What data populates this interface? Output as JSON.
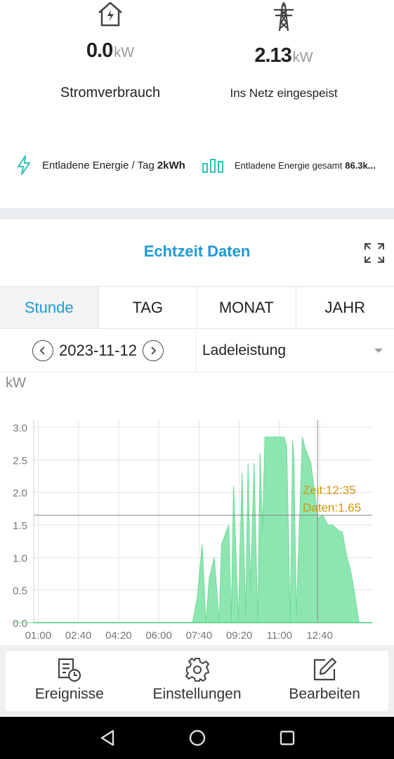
{
  "stats": {
    "consumption": {
      "value": "0.0",
      "unit": "kW",
      "label": "Stromverbrauch",
      "icon": "house-lightning-icon"
    },
    "grid": {
      "value": "2.13",
      "unit": "kW",
      "label": "Ins Netz eingespeist",
      "icon": "power-pylon-icon"
    }
  },
  "energy": {
    "daily": {
      "label": "Entladene Energie / Tag",
      "value": "2kWh",
      "icon": "lightning-icon"
    },
    "total": {
      "label": "Entladene Energie gesamt",
      "value": "86.3k...",
      "icon": "bar-chart-icon"
    }
  },
  "section": {
    "title": "Echtzeit Daten",
    "expand_icon": "expand-icon"
  },
  "tabs": [
    {
      "label": "Stunde",
      "active": true
    },
    {
      "label": "TAG",
      "active": false
    },
    {
      "label": "MONAT",
      "active": false
    },
    {
      "label": "JAHR",
      "active": false
    }
  ],
  "date_selector": {
    "date": "2023-11-12",
    "prev_icon": "chevron-left-icon",
    "next_icon": "chevron-right-icon"
  },
  "metric_select": {
    "value": "Ladeleistung"
  },
  "chart_data": {
    "type": "area",
    "ylabel": "kW",
    "ylim": [
      0,
      3.0
    ],
    "yticks": [
      "0.0",
      "0.5",
      "1.0",
      "1.5",
      "2.0",
      "2.5",
      "3.0"
    ],
    "xticks": [
      "01:00",
      "02:40",
      "04:20",
      "06:00",
      "07:40",
      "09:20",
      "11:00",
      "12:40"
    ],
    "x_hours": [
      0,
      7.4,
      7.6,
      7.8,
      7.95,
      8.1,
      8.3,
      8.5,
      8.6,
      8.9,
      9.0,
      9.1,
      9.3,
      9.45,
      9.6,
      9.7,
      9.8,
      9.95,
      10.1,
      10.2,
      10.3,
      10.4,
      10.6,
      11.0,
      11.2,
      11.3,
      11.45,
      11.55,
      11.6,
      11.7,
      11.95,
      12.05,
      12.3,
      12.6,
      12.8,
      13.0,
      13.2,
      13.5,
      13.6,
      13.8,
      13.95,
      14.05,
      14.3
    ],
    "values": [
      0,
      0,
      0.4,
      1.2,
      0,
      0.7,
      1.0,
      0,
      1.2,
      1.5,
      0,
      2.1,
      0,
      2.3,
      0.1,
      2.45,
      0.5,
      2.45,
      0,
      2.6,
      1.4,
      2.85,
      2.85,
      2.85,
      2.85,
      2.7,
      0,
      2.8,
      2.5,
      0.1,
      2.85,
      2.7,
      2.45,
      1.6,
      1.65,
      1.5,
      1.5,
      1.4,
      1.4,
      1.0,
      0.8,
      0.6,
      0
    ],
    "tooltip": {
      "time_label": "Zeit:12:35",
      "value_label": "Daten:1.65",
      "hour": 12.58,
      "value": 1.65
    },
    "series_color": "#8de6b0",
    "grid": true
  },
  "bottom_nav": [
    {
      "label": "Ereignisse",
      "icon": "events-icon"
    },
    {
      "label": "Einstellungen",
      "icon": "gear-icon"
    },
    {
      "label": "Bearbeiten",
      "icon": "edit-icon"
    }
  ],
  "system_nav": {
    "back_icon": "back-triangle-icon",
    "home_icon": "home-circle-icon",
    "recents_icon": "recents-square-icon"
  }
}
